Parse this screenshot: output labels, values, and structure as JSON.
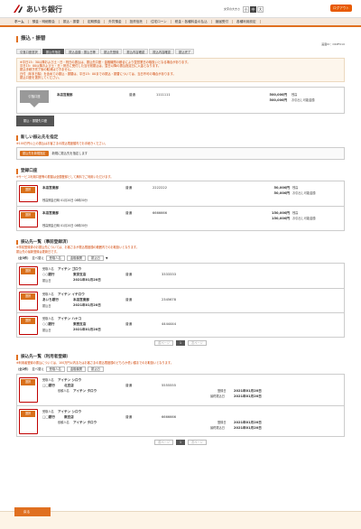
{
  "header": {
    "logo_text": "あいち銀行",
    "font_size_label": "文字の大きさ",
    "font_sizes": [
      "小",
      "中",
      "大"
    ],
    "logout_label": "ログアウト"
  },
  "nav": {
    "items": [
      "ホーム",
      "預金・明細照会",
      "振込・振替",
      "定期預金",
      "外貨預金",
      "投資信託",
      "住宅ローン",
      "税金・各種料金の払込",
      "諸届受付",
      "各種利用設定"
    ]
  },
  "page": {
    "title": "振込・振替",
    "page_id": "画面ID：DKPF010",
    "steps": [
      "引落口座選択",
      "振込先指定",
      "振込金額・振込日等",
      "振込先登録",
      "振込内容確認",
      "振込内容確認",
      "振込完了"
    ],
    "notice_lines": [
      "※平日15：30以降および土・日・祝日の振込は、振込先口座・金融機関の都合により翌営業日の取扱いとなる場合があります。",
      "平日15：00以降および土・日・祝日に受付した当行宛振込は、翌日以降の振込指定日に入金となります。",
      "振込手続き完了後の取消はできません。",
      "日付（年末日除）を含めての振込・振替は、平日15：00までの振込・振替については、当日不可の場合があります。",
      "振込口座を選択してください。"
    ]
  },
  "source": {
    "label": "引落口座",
    "branch": "本店営業部",
    "type": "普通",
    "number": "1111111",
    "amount1": "500,000円",
    "amount1_caption": "残高",
    "amount2": "500,000円",
    "amount2_caption": "お引出し可能金額",
    "to_label": "振込・振替先口座"
  },
  "new_dest": {
    "title": "新しい振込先を指定",
    "note": "※100万円以上の振込はお客さまの振込限度額内でお手続きください。",
    "button": "振込先を新規指定",
    "desc": "新規に振込先を指定します"
  },
  "registered": {
    "title": "登録口座",
    "note": "※サービス利用口座等の振替は全額登録として無料でご利用いただけます。",
    "rows": [
      {
        "select": "選択",
        "branch": "本店営業部",
        "type": "普通",
        "number": "2222222",
        "amount1": "50,000円",
        "cap1": "残高",
        "amount2": "50,000円",
        "cap2": "お引出し可能金額",
        "date_label": "残高照会日時",
        "date": "01月20日 08時30分"
      },
      {
        "select": "選択",
        "branch": "本店営業部",
        "type": "普通",
        "number": "6666666",
        "amount1": "150,000円",
        "cap1": "残高",
        "amount2": "150,000円",
        "cap2": "お引出し可能金額",
        "date_label": "残高照会日時",
        "date": "01月20日 08時30分"
      }
    ]
  },
  "list1": {
    "title": "振込先一覧（事前登録済）",
    "notes": [
      "※事前登録済のお振込先については、お客さまが振込限度額の範囲内でのお取扱いとなります。",
      "振込先の最新登録は更新日です。"
    ],
    "filter_label": "（全3件）",
    "sort_label": "並べ替え",
    "sort_options": [
      "受取人名",
      "金融機関",
      "振込日"
    ],
    "rows": [
      {
        "select": "選択",
        "name_label": "受取人名",
        "name": "アイチン ゴロウ",
        "bank": "○○銀行",
        "branch": "東京支店",
        "type": "普通",
        "number": "3333333",
        "date_label": "振込日",
        "date": "2021年01月20日"
      },
      {
        "select": "選択",
        "name_label": "受取人名",
        "name": "アイチン イチロウ",
        "bank": "あいち銀行",
        "branch": "本店営業部",
        "type": "普通",
        "number": "2345678",
        "date_label": "振込日",
        "date": "2021年01月20日"
      },
      {
        "select": "選択",
        "name_label": "受取人名",
        "name": "アイチン ハナコ",
        "bank": "○○銀行",
        "branch": "東西支店",
        "type": "普通",
        "number": "4444444",
        "date_label": "振込日",
        "date": "2021年01月20日"
      }
    ],
    "pager": {
      "prev": "前ページ",
      "current": "1",
      "next": "次ページ"
    }
  },
  "list2": {
    "title": "振込先一覧（利用者登録）",
    "note": "※利用者登録の振込については、100万円以内またはお客さまの振込限度額のどちらか低い額までのお取扱いとなります。",
    "filter_label": "（全2件）",
    "sort_label": "並べ替え",
    "sort_options": [
      "受取人名",
      "金融機関",
      "振込日"
    ],
    "rows": [
      {
        "select": "選択",
        "name_label": "受取人名",
        "name": "アイチン シロウ",
        "bank": "□□銀行",
        "branch": "北支店",
        "type": "普通",
        "number": "5555555",
        "payer_label": "依頼人名",
        "payer": "アイチン タロウ",
        "reg_label": "登録日",
        "reg_date": "2021年01月20日",
        "date_label": "最終振込日",
        "date": "2021年01月20日"
      },
      {
        "select": "選択",
        "name_label": "受取人名",
        "name": "アイチン シロウ",
        "bank": "□□銀行",
        "branch": "南支店",
        "type": "普通",
        "number": "6666666",
        "payer_label": "依頼人名",
        "payer": "アイチン タロウ",
        "reg_label": "登録日",
        "reg_date": "2021年01月20日",
        "date_label": "最終振込日",
        "date": "2021年01月20日"
      }
    ],
    "pager": {
      "prev": "前ページ",
      "current": "1",
      "next": "次ページ"
    }
  },
  "footer": {
    "back": "戻る"
  },
  "colors": {
    "accent": "#e07020",
    "button": "#d96f1a",
    "highlight": "#c00000"
  }
}
